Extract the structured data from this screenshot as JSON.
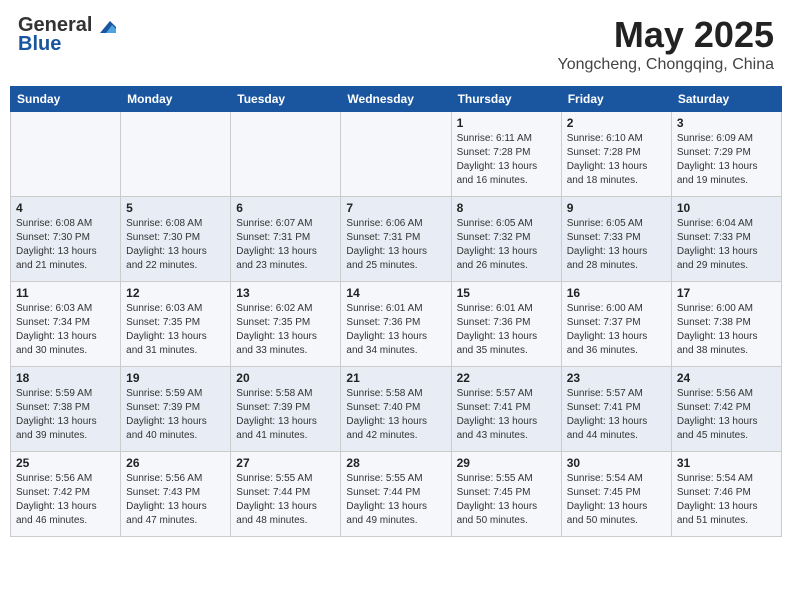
{
  "header": {
    "logo_general": "General",
    "logo_blue": "Blue",
    "month": "May 2025",
    "location": "Yongcheng, Chongqing, China"
  },
  "days_of_week": [
    "Sunday",
    "Monday",
    "Tuesday",
    "Wednesday",
    "Thursday",
    "Friday",
    "Saturday"
  ],
  "weeks": [
    [
      {
        "day": "",
        "info": ""
      },
      {
        "day": "",
        "info": ""
      },
      {
        "day": "",
        "info": ""
      },
      {
        "day": "",
        "info": ""
      },
      {
        "day": "1",
        "info": "Sunrise: 6:11 AM\nSunset: 7:28 PM\nDaylight: 13 hours\nand 16 minutes."
      },
      {
        "day": "2",
        "info": "Sunrise: 6:10 AM\nSunset: 7:28 PM\nDaylight: 13 hours\nand 18 minutes."
      },
      {
        "day": "3",
        "info": "Sunrise: 6:09 AM\nSunset: 7:29 PM\nDaylight: 13 hours\nand 19 minutes."
      }
    ],
    [
      {
        "day": "4",
        "info": "Sunrise: 6:08 AM\nSunset: 7:30 PM\nDaylight: 13 hours\nand 21 minutes."
      },
      {
        "day": "5",
        "info": "Sunrise: 6:08 AM\nSunset: 7:30 PM\nDaylight: 13 hours\nand 22 minutes."
      },
      {
        "day": "6",
        "info": "Sunrise: 6:07 AM\nSunset: 7:31 PM\nDaylight: 13 hours\nand 23 minutes."
      },
      {
        "day": "7",
        "info": "Sunrise: 6:06 AM\nSunset: 7:31 PM\nDaylight: 13 hours\nand 25 minutes."
      },
      {
        "day": "8",
        "info": "Sunrise: 6:05 AM\nSunset: 7:32 PM\nDaylight: 13 hours\nand 26 minutes."
      },
      {
        "day": "9",
        "info": "Sunrise: 6:05 AM\nSunset: 7:33 PM\nDaylight: 13 hours\nand 28 minutes."
      },
      {
        "day": "10",
        "info": "Sunrise: 6:04 AM\nSunset: 7:33 PM\nDaylight: 13 hours\nand 29 minutes."
      }
    ],
    [
      {
        "day": "11",
        "info": "Sunrise: 6:03 AM\nSunset: 7:34 PM\nDaylight: 13 hours\nand 30 minutes."
      },
      {
        "day": "12",
        "info": "Sunrise: 6:03 AM\nSunset: 7:35 PM\nDaylight: 13 hours\nand 31 minutes."
      },
      {
        "day": "13",
        "info": "Sunrise: 6:02 AM\nSunset: 7:35 PM\nDaylight: 13 hours\nand 33 minutes."
      },
      {
        "day": "14",
        "info": "Sunrise: 6:01 AM\nSunset: 7:36 PM\nDaylight: 13 hours\nand 34 minutes."
      },
      {
        "day": "15",
        "info": "Sunrise: 6:01 AM\nSunset: 7:36 PM\nDaylight: 13 hours\nand 35 minutes."
      },
      {
        "day": "16",
        "info": "Sunrise: 6:00 AM\nSunset: 7:37 PM\nDaylight: 13 hours\nand 36 minutes."
      },
      {
        "day": "17",
        "info": "Sunrise: 6:00 AM\nSunset: 7:38 PM\nDaylight: 13 hours\nand 38 minutes."
      }
    ],
    [
      {
        "day": "18",
        "info": "Sunrise: 5:59 AM\nSunset: 7:38 PM\nDaylight: 13 hours\nand 39 minutes."
      },
      {
        "day": "19",
        "info": "Sunrise: 5:59 AM\nSunset: 7:39 PM\nDaylight: 13 hours\nand 40 minutes."
      },
      {
        "day": "20",
        "info": "Sunrise: 5:58 AM\nSunset: 7:39 PM\nDaylight: 13 hours\nand 41 minutes."
      },
      {
        "day": "21",
        "info": "Sunrise: 5:58 AM\nSunset: 7:40 PM\nDaylight: 13 hours\nand 42 minutes."
      },
      {
        "day": "22",
        "info": "Sunrise: 5:57 AM\nSunset: 7:41 PM\nDaylight: 13 hours\nand 43 minutes."
      },
      {
        "day": "23",
        "info": "Sunrise: 5:57 AM\nSunset: 7:41 PM\nDaylight: 13 hours\nand 44 minutes."
      },
      {
        "day": "24",
        "info": "Sunrise: 5:56 AM\nSunset: 7:42 PM\nDaylight: 13 hours\nand 45 minutes."
      }
    ],
    [
      {
        "day": "25",
        "info": "Sunrise: 5:56 AM\nSunset: 7:42 PM\nDaylight: 13 hours\nand 46 minutes."
      },
      {
        "day": "26",
        "info": "Sunrise: 5:56 AM\nSunset: 7:43 PM\nDaylight: 13 hours\nand 47 minutes."
      },
      {
        "day": "27",
        "info": "Sunrise: 5:55 AM\nSunset: 7:44 PM\nDaylight: 13 hours\nand 48 minutes."
      },
      {
        "day": "28",
        "info": "Sunrise: 5:55 AM\nSunset: 7:44 PM\nDaylight: 13 hours\nand 49 minutes."
      },
      {
        "day": "29",
        "info": "Sunrise: 5:55 AM\nSunset: 7:45 PM\nDaylight: 13 hours\nand 50 minutes."
      },
      {
        "day": "30",
        "info": "Sunrise: 5:54 AM\nSunset: 7:45 PM\nDaylight: 13 hours\nand 50 minutes."
      },
      {
        "day": "31",
        "info": "Sunrise: 5:54 AM\nSunset: 7:46 PM\nDaylight: 13 hours\nand 51 minutes."
      }
    ]
  ]
}
